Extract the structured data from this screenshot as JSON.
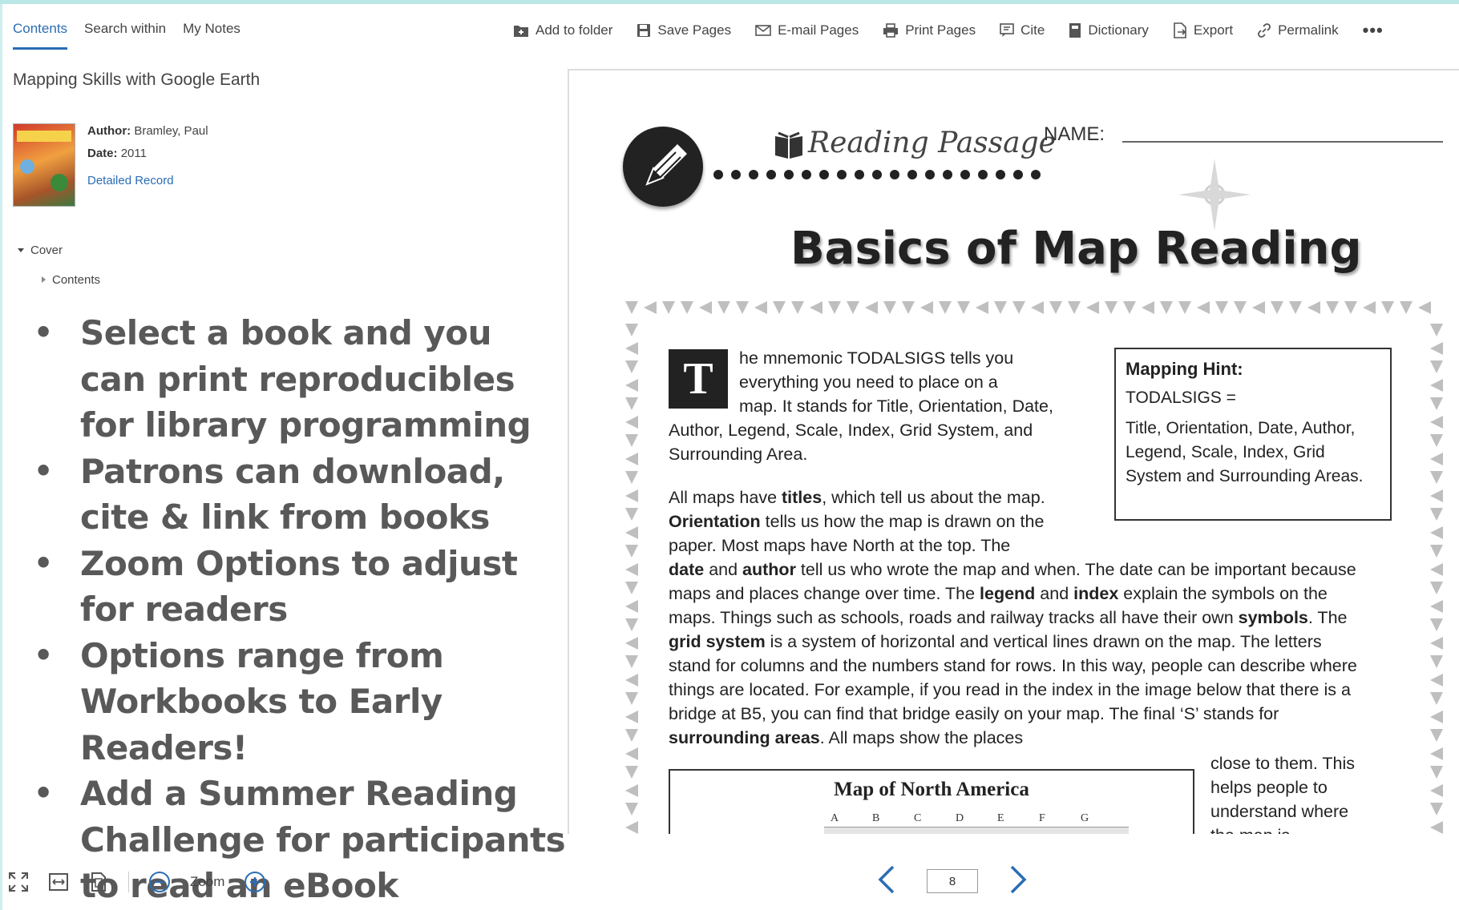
{
  "tabs": [
    {
      "label": "Contents",
      "active": true
    },
    {
      "label": "Search within",
      "active": false
    },
    {
      "label": "My Notes",
      "active": false
    }
  ],
  "toolbar": {
    "add_to_folder": "Add to folder",
    "save_pages": "Save Pages",
    "email_pages": "E-mail Pages",
    "print_pages": "Print Pages",
    "cite": "Cite",
    "dictionary": "Dictionary",
    "export": "Export",
    "permalink": "Permalink",
    "more": "•••"
  },
  "book": {
    "title": "Mapping Skills with Google Earth",
    "author_label": "Author:",
    "author": "Bramley, Paul",
    "date_label": "Date:",
    "date": "2011",
    "detailed_record": "Detailed Record"
  },
  "toc": [
    {
      "label": "Cover",
      "expanded": true
    },
    {
      "label": "Contents",
      "expanded": false
    }
  ],
  "bullets": [
    "Select a book and you can print reproducibles for library programming",
    "Patrons can download, cite & link from books",
    "Zoom Options to adjust for readers",
    "Options range from Workbooks to Early Readers!",
    "Add a Summer Reading Challenge for participants to read an eBook"
  ],
  "page": {
    "section_label": "Reading Passage",
    "name_label": "NAME:",
    "heading": "Basics of Map Reading",
    "drop_cap": "T",
    "para1_line1": "he mnemonic TODALSIGS tells you",
    "para1_line2": "everything you need to place on a",
    "para1_line3": "map. It stands for Title, Orientation, Date,",
    "para1_rest": "Author, Legend, Scale, Index, Grid System, and Surrounding Area.",
    "para2_a": "All maps have ",
    "para2_b": "titles",
    "para2_c": ", which tell us about the map.",
    "para2_d": "Orientation",
    "para2_e": " tells us how the map is drawn on the paper. Most maps have North at the top. The ",
    "para2_f": "date",
    "para2_g": " and ",
    "para2_h": "author",
    "para2_i": " tell us who wrote the map and when. The date can be important because maps and places change over time. The ",
    "para2_j": "legend",
    "para2_k": " and ",
    "para2_l": "index",
    "para2_m": " explain the symbols on the maps. Things such as schools, roads and railway tracks all have their own ",
    "para2_n": "symbols",
    "para2_o": ". The ",
    "para2_p": "grid system",
    "para2_q": " is a system of horizontal and vertical lines drawn on the map. The letters stand for columns and the numbers stand for rows. In this way, people can describe where things are located. For example, if you read in the index in the image below that there is a bridge at B5, you can find that bridge easily on your map. The final ‘S’ stands for ",
    "para2_r": "surrounding areas",
    "para2_s": ". All maps show the places",
    "side_text": "close to them. This helps people to understand where the map is",
    "hint": {
      "title": "Mapping Hint:",
      "equation": "TODALSIGS =",
      "body": "Title, Orientation, Date, Author, Legend, Scale, Index, Grid System and Surrounding Areas."
    },
    "map_title": "Map of North America",
    "map_columns": [
      "A",
      "B",
      "C",
      "D",
      "E",
      "F",
      "G"
    ]
  },
  "bottom": {
    "zoom_label": "Zoom",
    "page_number": "8"
  }
}
